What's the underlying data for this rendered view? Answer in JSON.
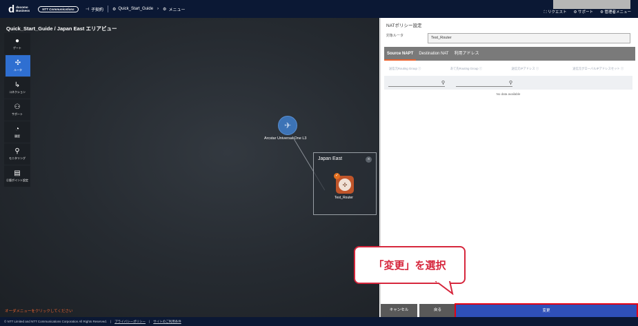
{
  "topbar": {
    "logo_main": "d",
    "logo_line1": "docomo",
    "logo_line2": "Business",
    "ntt_label": "NTT Communications",
    "project_label": "子契約",
    "workspace_label": "Quick_Start_Guide",
    "menu_label": "メニュー",
    "request_label": "リクエスト",
    "support_label": "サポート",
    "admin_label": "管理者メニュー"
  },
  "map": {
    "breadcrumb": "Quick_Start_Guide / Japan East エリアビュー",
    "cloud_label": "Arcstar Universal One L3",
    "region_title": "Japan East",
    "router_label": "Test_Router",
    "hint": "オーダメニューをクリックしてください"
  },
  "sidebar": [
    {
      "label": "ゲート",
      "icon": "gate-icon"
    },
    {
      "label": "ルータ",
      "icon": "router-icon"
    },
    {
      "label": "コネクション",
      "icon": "connection-icon"
    },
    {
      "label": "サポート",
      "icon": "support-icon"
    },
    {
      "label": "履歴",
      "icon": "history-icon"
    },
    {
      "label": "モニタリング",
      "icon": "monitoring-icon"
    },
    {
      "label": "Ⓒ版ポイント設定",
      "icon": "endpoint-icon"
    }
  ],
  "panel": {
    "title": "NATポリシー設定",
    "target_label": "対象ルータ",
    "target_value": "Test_Router",
    "tabs": [
      "Source NAPT",
      "Destination NAT",
      "利用アドレス"
    ],
    "columns": [
      "送信元Routing Group ⓘ",
      "あて先Routing Group ⓘ",
      "送信元IPアドレス ⓘ",
      "送信元グローバルIPアドレスセット ⓘ"
    ],
    "no_data": "No data available",
    "cancel_label": "キャンセル",
    "back_label": "戻る",
    "change_label": "変更"
  },
  "callout": "「変更」を選択",
  "footer": {
    "copyright": "© NTT Limited and NTT Communications Corporation All Rights Reserved.",
    "privacy_link": "プライバシーポリシー",
    "terms_link": "サイトのご利用条件"
  }
}
